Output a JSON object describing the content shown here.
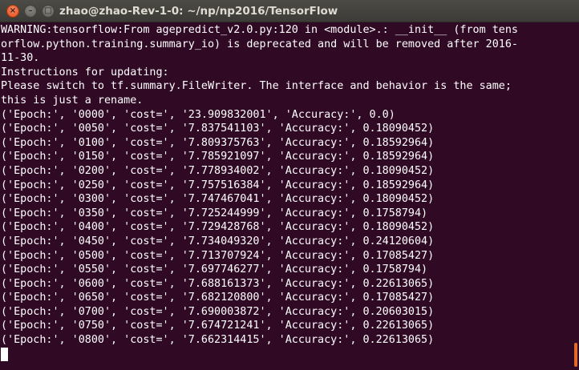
{
  "window": {
    "title": "zhao@zhao-Rev-1-0: ~/np/np2016/TensorFlow",
    "close_glyph": "×",
    "min_glyph": "–",
    "max_glyph": "□"
  },
  "terminal": {
    "lines": [
      "WARNING:tensorflow:From agepredict_v2.0.py:120 in <module>.: __init__ (from tens",
      "orflow.python.training.summary_io) is deprecated and will be removed after 2016-",
      "11-30.",
      "Instructions for updating:",
      "Please switch to tf.summary.FileWriter. The interface and behavior is the same;",
      "this is just a rename.",
      "('Epoch:', '0000', 'cost=', '23.909832001', 'Accuracy:', 0.0)",
      "('Epoch:', '0050', 'cost=', '7.837541103', 'Accuracy:', 0.18090452)",
      "('Epoch:', '0100', 'cost=', '7.809375763', 'Accuracy:', 0.18592964)",
      "('Epoch:', '0150', 'cost=', '7.785921097', 'Accuracy:', 0.18592964)",
      "('Epoch:', '0200', 'cost=', '7.778934002', 'Accuracy:', 0.18090452)",
      "('Epoch:', '0250', 'cost=', '7.757516384', 'Accuracy:', 0.18592964)",
      "('Epoch:', '0300', 'cost=', '7.747467041', 'Accuracy:', 0.18090452)",
      "('Epoch:', '0350', 'cost=', '7.725244999', 'Accuracy:', 0.1758794)",
      "('Epoch:', '0400', 'cost=', '7.729428768', 'Accuracy:', 0.18090452)",
      "('Epoch:', '0450', 'cost=', '7.734049320', 'Accuracy:', 0.24120604)",
      "('Epoch:', '0500', 'cost=', '7.713707924', 'Accuracy:', 0.17085427)",
      "('Epoch:', '0550', 'cost=', '7.697746277', 'Accuracy:', 0.1758794)",
      "('Epoch:', '0600', 'cost=', '7.688161373', 'Accuracy:', 0.22613065)",
      "('Epoch:', '0650', 'cost=', '7.682120800', 'Accuracy:', 0.17085427)",
      "('Epoch:', '0700', 'cost=', '7.690003872', 'Accuracy:', 0.20603015)",
      "('Epoch:', '0750', 'cost=', '7.674721241', 'Accuracy:', 0.22613065)",
      "('Epoch:', '0800', 'cost=', '7.662314415', 'Accuracy:', 0.22613065)"
    ]
  },
  "colors": {
    "background": "#300a24",
    "text": "#ffffff",
    "titlebar": "#3c3b37",
    "close_button": "#df4a16",
    "scrollbar_thumb": "#e2692c"
  }
}
